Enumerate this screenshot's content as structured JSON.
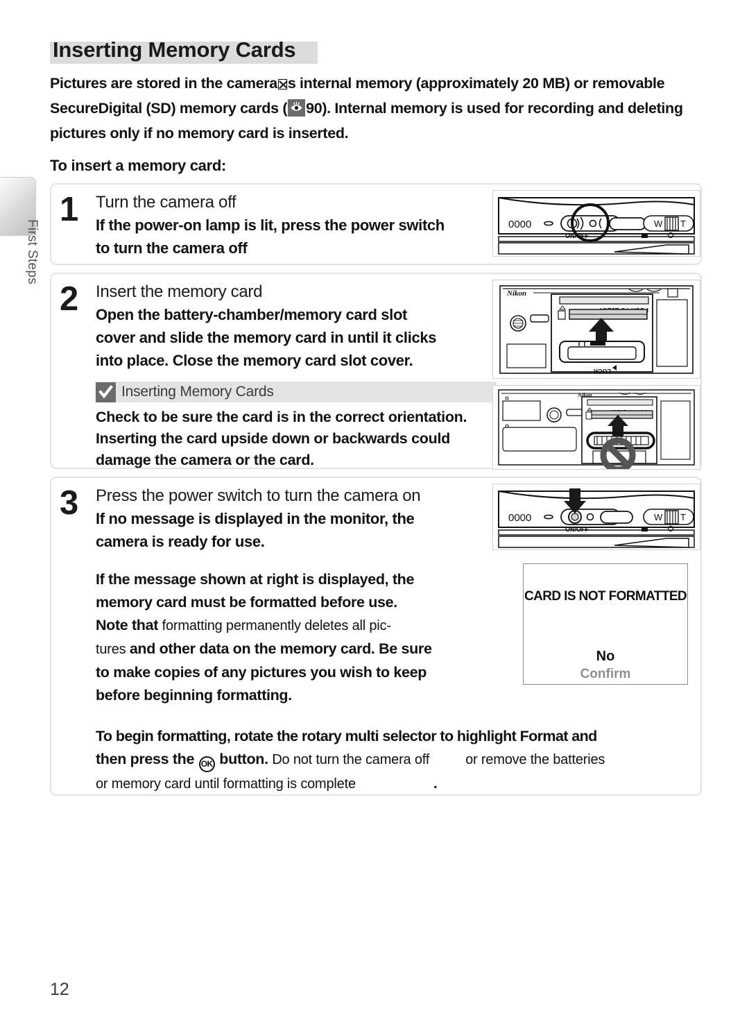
{
  "sidebar": {
    "chapter_label": "First Steps"
  },
  "page": {
    "title": "Inserting Memory Cards",
    "number": "12",
    "intro_line1_a": "Pictures are stored in the camera",
    "intro_line1_b": "s internal memory (approximately 20 MB) or",
    "intro_line2_a": "removable ",
    "intro_line2_b": "Secure",
    "intro_line2_c": "Digital (SD) memory cards (",
    "intro_line2_d": "90).  Internal memory is used for",
    "intro_line3": "recording and deleting pictures only if no memory card is inserted.",
    "subheading": "To insert a memory card:"
  },
  "steps": [
    {
      "number": "1",
      "title": "Turn the camera off",
      "text_line1": "If the power-on lamp is lit, press the power switch",
      "text_line2": "to turn the camera off",
      "illustration": "camera-top-power-switch-highlight"
    },
    {
      "number": "2",
      "title": "Insert the memory card",
      "text_line1": "Open  the  battery-chamber/memory  card  slot",
      "text_line2": "cover and slide the memory card in until it clicks",
      "text_line3": "into place.  Close the memory card slot cover.",
      "illustration": "battery-chamber-card-insert"
    },
    {
      "number": "3",
      "title": "Press the power switch to turn the camera on",
      "text_line1": "If  no  message  is  displayed  in  the  monitor,  the",
      "text_line2": "camera is ready for use.",
      "illustration": "camera-top-power-switch-press"
    }
  ],
  "caution": {
    "title": "Inserting Memory Cards",
    "line1": "Check to be sure the card is in the correct orientation.",
    "line2": "Inserting  the  card  upside  down  or  backwards  could",
    "line3": "damage the camera or the card.",
    "illustration": "battery-chamber-wrong-orientation-prohibited"
  },
  "format_warning": {
    "line1": "If  the  message  shown  at  right  is  displayed,  the",
    "line2": "memory  card  must  be  formatted  before  use.",
    "line3_bold": "Note that ",
    "line3_light": "formatting permanently deletes all pic-",
    "line4_light": "tures ",
    "line4_bold": " and other data on the memory card. Be sure",
    "line5": "to make copies of any pictures you wish to keep",
    "line6": "before beginning formatting.",
    "final_line1_a": "To begin formatting, rotate the rotary multi selector to highlight ",
    "final_line1_b": "Format",
    "final_line1_c": " and",
    "final_line2_a": "then press the ",
    "final_line2_b": " button. ",
    "final_line2_c": "Do  not turn the camera off",
    "final_line2_d": "or remove the batteries",
    "final_line3": "or memory card until formatting is complete",
    "final_period": "."
  },
  "monitor": {
    "message": "CARD IS NOT FORMATTED",
    "option_no": "No",
    "option_confirm": "Confirm"
  },
  "illustration_labels": {
    "camera_brand": "Nikon",
    "power_label": "ON/OFF",
    "zoom_wide": "W",
    "zoom_tele": "T",
    "counter": "0000",
    "push_to_eject": "PUSH TO EJECT",
    "lock": "LOCK"
  },
  "colors": {
    "title_highlight": "#dcdcdc",
    "box_border": "#e2e2e2",
    "caution_header": "#e3e3e3",
    "icon_gray": "#6b6b6b",
    "text": "#111111",
    "muted_text": "#8e8e8e"
  }
}
